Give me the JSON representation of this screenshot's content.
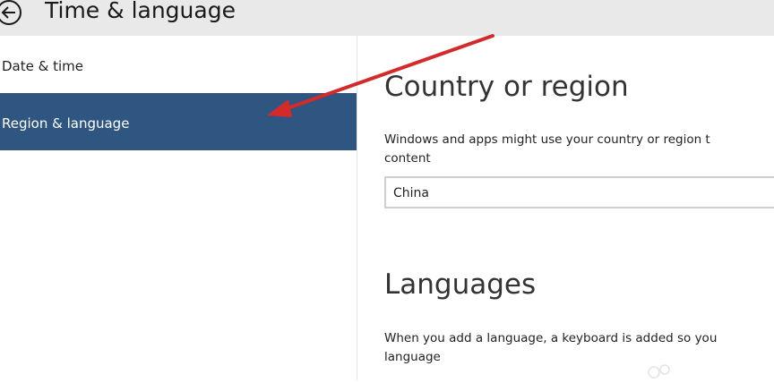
{
  "header": {
    "title": "Time & language"
  },
  "sidebar": {
    "items": [
      {
        "label": "Date & time",
        "selected": false
      },
      {
        "label": "Region & language",
        "selected": true
      }
    ],
    "accent_color": "#2f5680"
  },
  "main": {
    "country_region": {
      "title": "Country or region",
      "description_line1": "Windows and apps might use your country or region t",
      "description_line2": "content",
      "selected_country": "China"
    },
    "languages": {
      "title": "Languages",
      "description_line1": "When you add a language, a keyboard is added so you",
      "description_line2": "language"
    }
  },
  "annotation": {
    "arrow_color": "#d42a2a"
  },
  "icons": {
    "back": "back-arrow-icon",
    "dropdown": "chevron-down-icon"
  }
}
